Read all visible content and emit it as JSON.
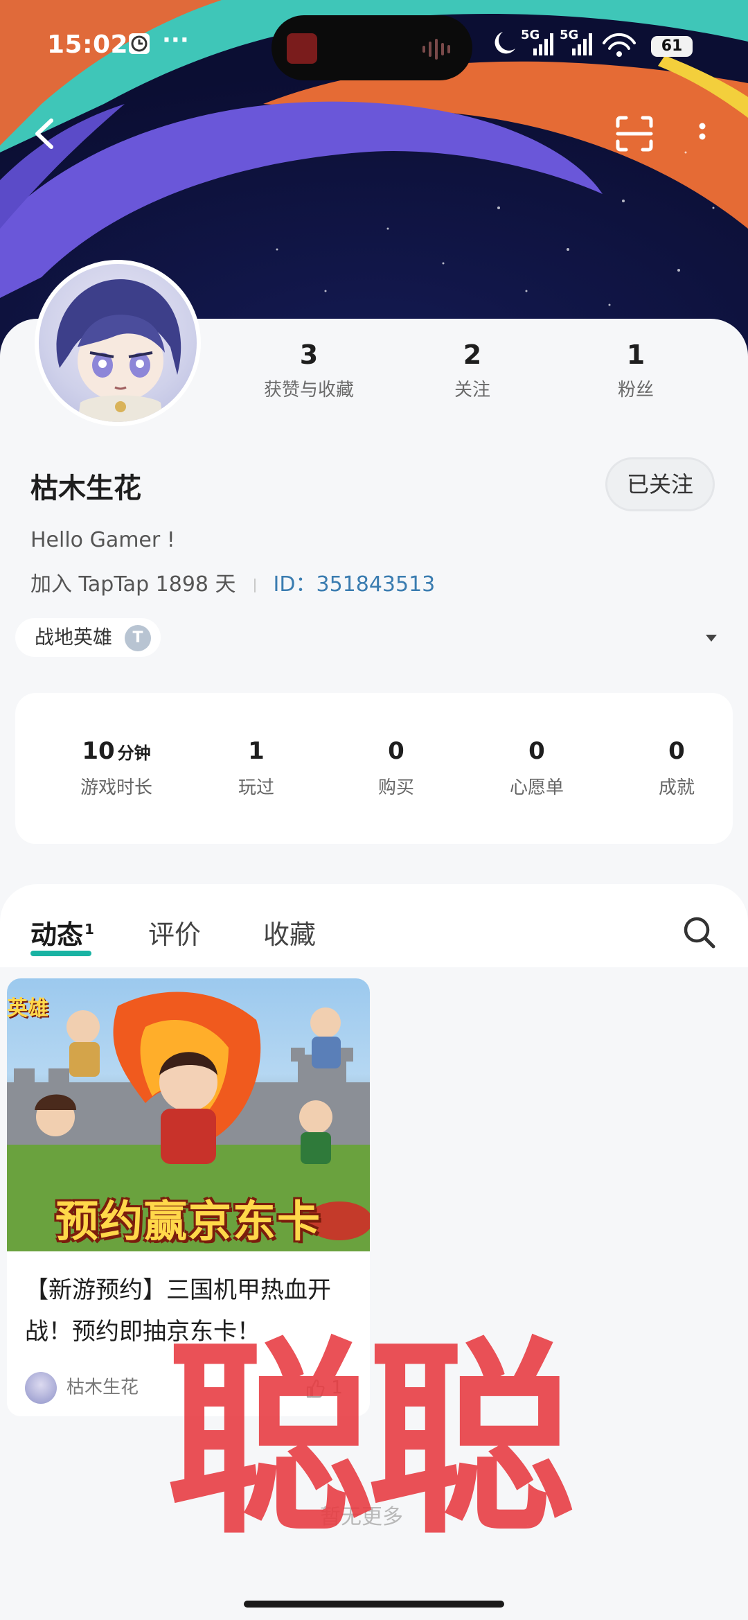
{
  "status_bar": {
    "time": "15:02",
    "dots": "···",
    "battery": "61",
    "network_1": "5G",
    "network_2": "5G"
  },
  "header": {
    "back_icon": "chevron-left-icon",
    "scan_icon": "scan-icon",
    "more_icon": "more-vertical-icon"
  },
  "profile": {
    "stats": [
      {
        "value": "3",
        "label": "获赞与收藏"
      },
      {
        "value": "2",
        "label": "关注"
      },
      {
        "value": "1",
        "label": "粉丝"
      }
    ],
    "name": "枯木生花",
    "follow_button": "已关注",
    "bio": "Hello Gamer !",
    "joined": "加入 TapTap 1898 天",
    "id_label": "ID：",
    "id_value": "351843513",
    "game_chip": "战地英雄"
  },
  "game_stats": [
    {
      "value": "10",
      "unit": "分钟",
      "label": "游戏时长"
    },
    {
      "value": "1",
      "unit": "",
      "label": "玩过"
    },
    {
      "value": "0",
      "unit": "",
      "label": "购买"
    },
    {
      "value": "0",
      "unit": "",
      "label": "心愿单"
    },
    {
      "value": "0",
      "unit": "",
      "label": "成就"
    }
  ],
  "tabs": {
    "items": [
      {
        "label": "动态",
        "badge": "1"
      },
      {
        "label": "评价",
        "badge": ""
      },
      {
        "label": "收藏",
        "badge": ""
      }
    ],
    "active": "动态"
  },
  "post": {
    "image_text": "预约赢京东卡",
    "corner_tag": "英雄",
    "title": "【新游预约】三国机甲热血开战！预约即抽京东卡！",
    "author": "枯木生花",
    "likes": "1"
  },
  "no_more": "暂无更多",
  "watermark": "聪聪",
  "colors": {
    "accent": "#19b3a3",
    "id_link": "#3a7cb0",
    "watermark": "#e83a40"
  }
}
